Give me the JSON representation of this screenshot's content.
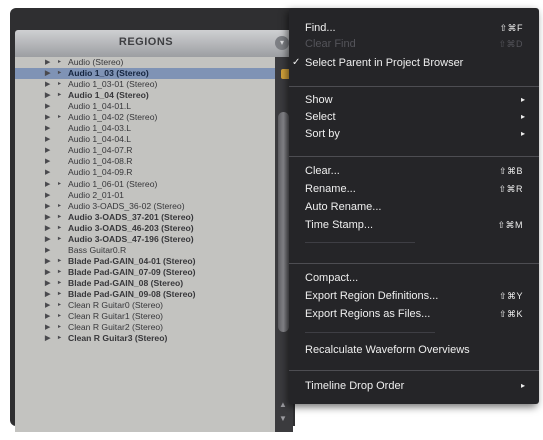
{
  "panel": {
    "title": "REGIONS",
    "rows": [
      {
        "label": "Audio (Stereo)",
        "bold": false,
        "selected": false,
        "tri2": true
      },
      {
        "label": "Audio 1_03 (Stereo)",
        "bold": true,
        "selected": true,
        "tri2": true
      },
      {
        "label": "Audio 1_03-01 (Stereo)",
        "bold": false,
        "selected": false,
        "tri2": true
      },
      {
        "label": "Audio 1_04 (Stereo)",
        "bold": true,
        "selected": false,
        "tri2": true
      },
      {
        "label": "Audio 1_04-01.L",
        "bold": false,
        "selected": false,
        "tri2": false
      },
      {
        "label": "Audio 1_04-02 (Stereo)",
        "bold": false,
        "selected": false,
        "tri2": true
      },
      {
        "label": "Audio 1_04-03.L",
        "bold": false,
        "selected": false,
        "tri2": false
      },
      {
        "label": "Audio 1_04-04.L",
        "bold": false,
        "selected": false,
        "tri2": false
      },
      {
        "label": "Audio 1_04-07.R",
        "bold": false,
        "selected": false,
        "tri2": false
      },
      {
        "label": "Audio 1_04-08.R",
        "bold": false,
        "selected": false,
        "tri2": false
      },
      {
        "label": "Audio 1_04-09.R",
        "bold": false,
        "selected": false,
        "tri2": false
      },
      {
        "label": "Audio 1_06-01 (Stereo)",
        "bold": false,
        "selected": false,
        "tri2": true
      },
      {
        "label": "Audio 2_01-01",
        "bold": false,
        "selected": false,
        "tri2": false
      },
      {
        "label": "Audio 3-OADS_36-02 (Stereo)",
        "bold": false,
        "selected": false,
        "tri2": true
      },
      {
        "label": "Audio 3-OADS_37-201 (Stereo)",
        "bold": true,
        "selected": false,
        "tri2": true
      },
      {
        "label": "Audio 3-OADS_46-203 (Stereo)",
        "bold": true,
        "selected": false,
        "tri2": true
      },
      {
        "label": "Audio 3-OADS_47-196 (Stereo)",
        "bold": true,
        "selected": false,
        "tri2": true
      },
      {
        "label": "Bass Guitar0.R",
        "bold": false,
        "selected": false,
        "tri2": false
      },
      {
        "label": "Blade Pad-GAIN_04-01 (Stereo)",
        "bold": true,
        "selected": false,
        "tri2": true
      },
      {
        "label": "Blade Pad-GAIN_07-09 (Stereo)",
        "bold": true,
        "selected": false,
        "tri2": true
      },
      {
        "label": "Blade Pad-GAIN_08 (Stereo)",
        "bold": true,
        "selected": false,
        "tri2": true
      },
      {
        "label": "Blade Pad-GAIN_09-08 (Stereo)",
        "bold": true,
        "selected": false,
        "tri2": true
      },
      {
        "label": "Clean R Guitar0 (Stereo)",
        "bold": false,
        "selected": false,
        "tri2": true
      },
      {
        "label": "Clean R Guitar1 (Stereo)",
        "bold": false,
        "selected": false,
        "tri2": true
      },
      {
        "label": "Clean R Guitar2 (Stereo)",
        "bold": false,
        "selected": false,
        "tri2": true
      },
      {
        "label": "Clean R Guitar3 (Stereo)",
        "bold": true,
        "selected": false,
        "tri2": true
      }
    ]
  },
  "menu": {
    "find": {
      "label": "Find...",
      "shortcut": "⇧⌘F"
    },
    "clear_find": {
      "label": "Clear Find",
      "shortcut": "⇧⌘D"
    },
    "select_parent": {
      "label": "Select Parent in Project Browser",
      "check": "✓"
    },
    "show": {
      "label": "Show",
      "arrow": "▸"
    },
    "select": {
      "label": "Select",
      "arrow": "▸"
    },
    "sort_by": {
      "label": "Sort by",
      "arrow": "▸"
    },
    "clear": {
      "label": "Clear...",
      "shortcut": "⇧⌘B"
    },
    "rename": {
      "label": "Rename...",
      "shortcut": "⇧⌘R"
    },
    "auto_rename": {
      "label": "Auto Rename..."
    },
    "time_stamp": {
      "label": "Time Stamp...",
      "shortcut": "⇧⌘M"
    },
    "compact": {
      "label": "Compact..."
    },
    "export_defs": {
      "label": "Export Region Definitions...",
      "shortcut": "⇧⌘Y"
    },
    "export_files": {
      "label": "Export Regions as Files...",
      "shortcut": "⇧⌘K"
    },
    "recalc": {
      "label": "Recalculate Waveform Overviews"
    },
    "timeline_drop": {
      "label": "Timeline Drop Order",
      "arrow": "▸"
    }
  },
  "icons": {
    "row_expand": "▶",
    "row_sub": "▸",
    "panel_menu": "▾",
    "scroll_up": "▲",
    "scroll_down": "▼"
  }
}
